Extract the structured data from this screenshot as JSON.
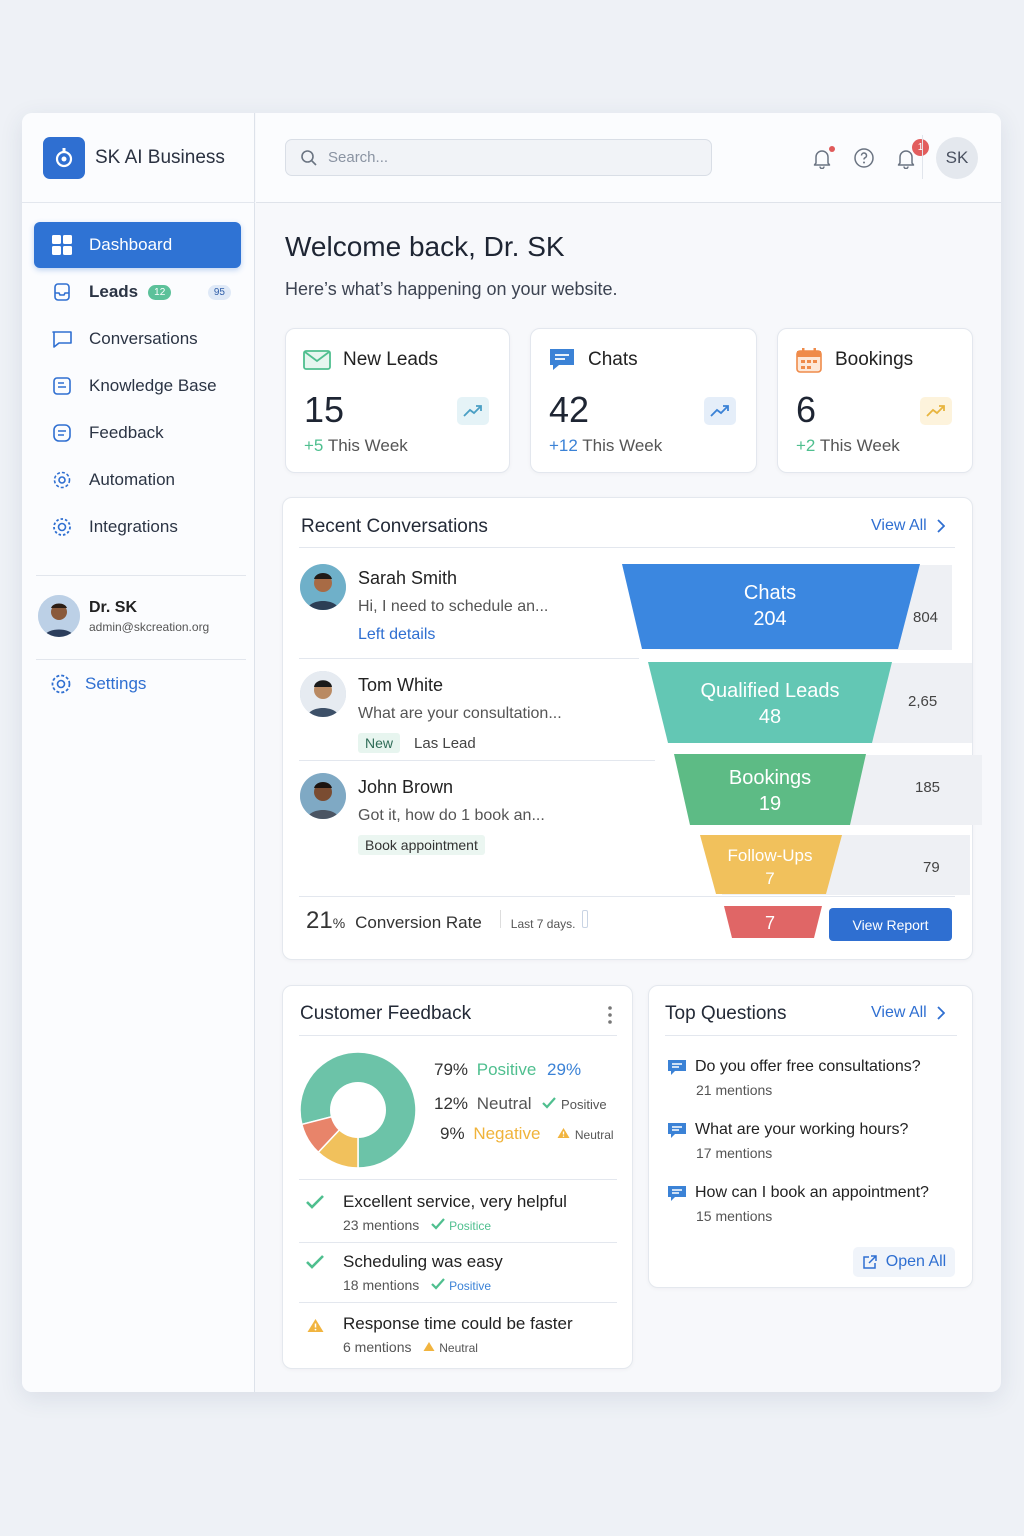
{
  "brand": {
    "name": "SK AI Business"
  },
  "sidebar": {
    "items": [
      {
        "label": "Dashboard",
        "icon": "grid-icon"
      },
      {
        "label": "Leads",
        "icon": "inbox-icon",
        "badge": "12",
        "count": "95"
      },
      {
        "label": "Conversations",
        "icon": "chat-icon"
      },
      {
        "label": "Knowledge Base",
        "icon": "book-icon"
      },
      {
        "label": "Feedback",
        "icon": "feedback-icon"
      },
      {
        "label": "Automation",
        "icon": "gear-icon"
      },
      {
        "label": "Integrations",
        "icon": "cog-icon"
      }
    ],
    "profile": {
      "name": "Dr. SK",
      "email": "admin@skcreation.org"
    },
    "settings_label": "Settings"
  },
  "topbar": {
    "search_placeholder": "Search...",
    "notifications_count": "1",
    "user_initials": "SK"
  },
  "welcome": {
    "title": "Welcome back, Dr. SK",
    "subtitle": "Here’s what’s happening on your website."
  },
  "stats": [
    {
      "label": "New Leads",
      "value": "15",
      "delta": "+5",
      "period": "This Week",
      "icon": "mail-icon",
      "color": "#4fbf8f"
    },
    {
      "label": "Chats",
      "value": "42",
      "delta": "+12",
      "period": "This Week",
      "icon": "chat-bubble-icon",
      "color": "#3b82d6"
    },
    {
      "label": "Bookings",
      "value": "6",
      "delta": "+2",
      "period": "This Week",
      "icon": "calendar-icon",
      "color": "#4fbf8f"
    }
  ],
  "recent": {
    "title": "Recent Conversations",
    "view_all": "View All",
    "items": [
      {
        "name": "Sarah Smith",
        "message": "Hi, I need to schedule an...",
        "tag": "Left details"
      },
      {
        "name": "Tom White",
        "message": "What are your consultation...",
        "tag": "New",
        "tag2": "Las Lead"
      },
      {
        "name": "John Brown",
        "message": "Got it, how do 1 book an...",
        "tag": "Book appointment"
      }
    ],
    "funnel": [
      {
        "label": "Chats",
        "value": "204",
        "count": "804",
        "color": "#3b87e0"
      },
      {
        "label": "Qualified Leads",
        "value": "48",
        "count": "2,65",
        "color": "#63c7b4"
      },
      {
        "label": "Bookings",
        "value": "19",
        "count": "185",
        "color": "#5dbb85"
      },
      {
        "label": "Follow-Ups",
        "value": "7",
        "count": "79",
        "color": "#f1c15c"
      },
      {
        "label": "",
        "value": "7",
        "count": "",
        "color": "#e06666"
      }
    ],
    "conversion_value": "21",
    "conversion_unit": "%",
    "conversion_label": "Conversion Rate",
    "period": "Last 7 days.",
    "view_report": "View Report"
  },
  "feedback": {
    "title": "Customer Feedback",
    "legend": [
      {
        "pct": "79%",
        "label": "Positive",
        "extra": "29%"
      },
      {
        "pct": "12%",
        "label": "Neutral",
        "extra": "Positive"
      },
      {
        "pct": "9%",
        "label": "Negative",
        "extra": "Neutral"
      }
    ],
    "items": [
      {
        "text": "Excellent service, very helpful",
        "mentions": "23 mentions",
        "status": "Positice"
      },
      {
        "text": "Scheduling was easy",
        "mentions": "18 mentions",
        "status": "Positive"
      },
      {
        "text": "Response time could be faster",
        "mentions": "6 mentions",
        "status": "Neutral"
      }
    ],
    "colors": {
      "positive": "#6cc3a8",
      "neutral": "#f1c15c",
      "negative": "#e8846a"
    }
  },
  "questions": {
    "title": "Top Questions",
    "view_all": "View All",
    "items": [
      {
        "text": "Do you offer free consultations?",
        "mentions": "21 mentions"
      },
      {
        "text": "What are your working hours?",
        "mentions": "17 mentions"
      },
      {
        "text": "How can I book an appointment?",
        "mentions": "15 mentions"
      }
    ],
    "open_all": "Open All"
  }
}
